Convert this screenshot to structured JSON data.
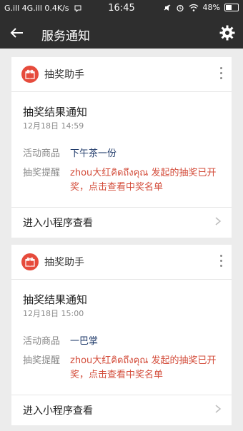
{
  "status_bar": {
    "left_text": "G.ill 4G.ill 0.4K/s",
    "time": "16:45",
    "battery_text": "48%",
    "icons": [
      "signal-icon",
      "lte-icon",
      "chat-bubble-icon",
      "mute-icon",
      "alarm-icon",
      "wifi-icon",
      "battery-icon"
    ]
  },
  "app_bar": {
    "title": "服务通知",
    "back_icon": "arrow-left-icon",
    "settings_icon": "gear-icon",
    "bg_color": "#2e2e2e"
  },
  "cards": [
    {
      "sender": "抽奖助手",
      "title": "抽奖结果通知",
      "time": "12月18日  14:59",
      "prize_label": "活动商品",
      "prize_value": "下午茶一份",
      "remind_label": "抽奖提醒",
      "remind_value": "zhou大红คิดถึงคุณ 发起的抽奖已开奖，点击查看中奖名单",
      "action": "进入小程序查看"
    },
    {
      "sender": "抽奖助手",
      "title": "抽奖结果通知",
      "time": "12月18日  15:00",
      "prize_label": "活动商品",
      "prize_value": "一巴掌",
      "remind_label": "抽奖提醒",
      "remind_value": "zhou大红คิดถึงคุณ 发起的抽奖已开奖，点击查看中奖名单",
      "action": "进入小程序查看"
    }
  ],
  "colors": {
    "accent_red": "#e64b3c",
    "remind_text": "#d34c3a",
    "prize_text": "#1f3a6a"
  }
}
